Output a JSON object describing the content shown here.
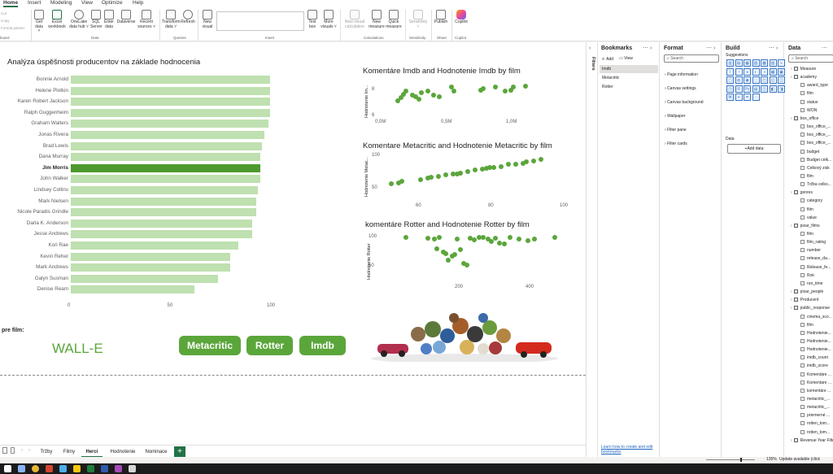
{
  "ribbon_tabs": [
    "Home",
    "Insert",
    "Modeling",
    "View",
    "Optimize",
    "Help"
  ],
  "ribbon_left_items": [
    "Cut",
    "Copy",
    "Format painter"
  ],
  "clipboard_label": "board",
  "ribbon": {
    "data": [
      {
        "label": "Get data ˅"
      },
      {
        "label": "Excel workbook"
      },
      {
        "label": "OneLake data hub ˅"
      },
      {
        "label": "SQL Server"
      },
      {
        "label": "Enter data"
      },
      {
        "label": "Dataverse"
      },
      {
        "label": "Recent sources ˅"
      }
    ],
    "queries": [
      {
        "label": "Transform data ˅"
      },
      {
        "label": "Refresh"
      }
    ],
    "insert": [
      {
        "label": "New visual"
      },
      {
        "label": "Text box"
      },
      {
        "label": "More visuals ˅"
      }
    ],
    "calculations": [
      {
        "label": "New visual calculation"
      },
      {
        "label": "New measure"
      },
      {
        "label": "Quick measure"
      }
    ],
    "sensitivity": [
      {
        "label": "Sensitivity ˅"
      }
    ],
    "share": [
      {
        "label": "Publish"
      }
    ],
    "copilot": [
      {
        "label": "Copilot"
      }
    ],
    "groups": [
      "Data",
      "Queries",
      "Insert",
      "Calculations",
      "Sensitivity",
      "Share",
      "Copilot"
    ]
  },
  "chart_data": [
    {
      "type": "bar",
      "title": "Analýza úspěšnosti producentov na základe hodnocenia",
      "categories": [
        "Bonnie Arnold",
        "Helene Plotkin",
        "Karen Robert Jackson",
        "Ralph Guggenheim",
        "Graham Walters",
        "Jonas Rivera",
        "Brad Lewis",
        "Dana Murray",
        "Jim Morris",
        "John Walker",
        "Lindsey Collins",
        "Mark Nielsen",
        "Nicole Paradis Grindle",
        "Darla K. Anderson",
        "Jesse Andrews",
        "Kori Rae",
        "Kevin Reher",
        "Mark Andrews",
        "Galyn Susman",
        "Denise Ream"
      ],
      "values": [
        100,
        100,
        100,
        100,
        99,
        97,
        96,
        95,
        95,
        95,
        94,
        93,
        93,
        91,
        91,
        84,
        80,
        80,
        74,
        62
      ],
      "highlighted": "Jim Morris",
      "xticks": [
        "0",
        "50",
        "100"
      ],
      "xlim": [
        0,
        100
      ]
    },
    {
      "type": "scatter",
      "title": "Komentáre Imdb and Hodnotenie Imdb by film",
      "ylabel": "Hodnotenie Im...",
      "xticks": [
        "0,0M",
        "0,5M",
        "1,0M"
      ],
      "yticks": [
        "6",
        "8"
      ],
      "xlim": [
        0,
        1.4
      ],
      "ylim": [
        6,
        8.6
      ],
      "x": [
        0.15,
        0.18,
        0.2,
        0.22,
        0.27,
        0.3,
        0.33,
        0.35,
        0.4,
        0.45,
        0.5,
        0.6,
        0.62,
        0.85,
        0.87,
        0.97,
        1.05,
        1.1,
        1.12,
        1.22
      ],
      "y": [
        7.2,
        7.4,
        7.7,
        7.9,
        7.6,
        7.5,
        7.3,
        7.8,
        7.9,
        7.6,
        7.5,
        8.2,
        7.9,
        8.0,
        8.1,
        8.2,
        7.9,
        8.0,
        8.2,
        8.3
      ]
    },
    {
      "type": "scatter",
      "title": "Komentare Metacritic and Hodnotenie Metacritic by film",
      "ylabel": "Hodnotenie Metac...",
      "xticks": [
        "60",
        "80",
        "100"
      ],
      "yticks": [
        "50",
        "100"
      ],
      "xlim": [
        50,
        100
      ],
      "ylim": [
        40,
        105
      ],
      "x": [
        53,
        55,
        56,
        61,
        63,
        64,
        66,
        68,
        70,
        71,
        72,
        74,
        76,
        78,
        79,
        80,
        81,
        83,
        85,
        87,
        89,
        90,
        92,
        94
      ],
      "y": [
        57,
        59,
        61,
        64,
        66,
        67,
        69,
        71,
        72,
        73,
        74,
        76,
        79,
        80,
        81,
        82,
        83,
        84,
        87,
        88,
        89,
        91,
        93,
        95
      ]
    },
    {
      "type": "scatter",
      "title": "komentáre Rotter and Hodnotenie Rotter by film",
      "ylabel": "Hodnotenie Rotter",
      "xticks": [
        "200",
        "400"
      ],
      "yticks": [
        "50",
        "100"
      ],
      "xlim": [
        60,
        480
      ],
      "ylim": [
        30,
        105
      ],
      "x": [
        125,
        175,
        190,
        195,
        200,
        210,
        215,
        220,
        230,
        235,
        240,
        248,
        255,
        262,
        270,
        280,
        290,
        300,
        310,
        318,
        326,
        336,
        346,
        360,
        380,
        400,
        415,
        460
      ],
      "y": [
        100,
        98,
        96,
        80,
        99,
        75,
        72,
        60,
        68,
        70,
        97,
        78,
        55,
        52,
        98,
        95,
        99,
        100,
        96,
        92,
        98,
        90,
        89,
        99,
        97,
        94,
        96,
        99
      ]
    }
  ],
  "slicer_label": "pre film:",
  "selected_film": "WALL-E",
  "buttons": [
    "Metacritic",
    "Rotter",
    "Imdb"
  ],
  "filters_label": "Filters",
  "bookmarks": {
    "title": "Bookmarks",
    "add": "Add",
    "view": "View",
    "items": [
      "Imdb",
      "Metacritic",
      "Rotter"
    ],
    "footer": "Learn how to create and edit bookmarks"
  },
  "format": {
    "title": "Format",
    "search_placeholder": "Search",
    "items": [
      "Page information",
      "Canvas settings",
      "Canvas background",
      "Wallpaper",
      "Filter pane",
      "Filter cards"
    ]
  },
  "build": {
    "title": "Build",
    "suggestions": "Suggestions",
    "data_label": "Data",
    "add_data": "+Add data"
  },
  "data_pane": {
    "title": "Data",
    "search_placeholder": "Search",
    "fields": [
      {
        "t": "Measure",
        "level": 0
      },
      {
        "t": "academy",
        "level": 0
      },
      {
        "t": "award_type",
        "level": 1
      },
      {
        "t": "film",
        "level": 1
      },
      {
        "t": "status",
        "level": 1
      },
      {
        "t": "WON",
        "level": 1
      },
      {
        "t": "box_office",
        "level": 0
      },
      {
        "t": "box_office_...",
        "level": 1
      },
      {
        "t": "box_office_...",
        "level": 1
      },
      {
        "t": "box_office_...",
        "level": 1
      },
      {
        "t": "budget",
        "level": 1
      },
      {
        "t": "Budget celk...",
        "level": 1
      },
      {
        "t": "Celkový zisk",
        "level": 1
      },
      {
        "t": "film",
        "level": 1
      },
      {
        "t": "Tržba celko...",
        "level": 1
      },
      {
        "t": "genres",
        "level": 0
      },
      {
        "t": "category",
        "level": 1
      },
      {
        "t": "film",
        "level": 1
      },
      {
        "t": "value",
        "level": 1
      },
      {
        "t": "pixar_films",
        "level": 0
      },
      {
        "t": "film",
        "level": 1
      },
      {
        "t": "film_rating",
        "level": 1
      },
      {
        "t": "number",
        "level": 1
      },
      {
        "t": "release_da...",
        "level": 1
      },
      {
        "t": "Release_fe...",
        "level": 1
      },
      {
        "t": "Rok",
        "level": 1
      },
      {
        "t": "run_time",
        "level": 1
      },
      {
        "t": "pixar_people",
        "level": 0
      },
      {
        "t": "Producent",
        "level": 0
      },
      {
        "t": "public_response",
        "level": 0
      },
      {
        "t": "cinema_sco...",
        "level": 1
      },
      {
        "t": "film",
        "level": 1
      },
      {
        "t": "Hodnotenie...",
        "level": 1
      },
      {
        "t": "Hodnotenie...",
        "level": 1
      },
      {
        "t": "Hodnotenie...",
        "level": 1
      },
      {
        "t": "imdb_count",
        "level": 1
      },
      {
        "t": "imdb_score",
        "level": 1
      },
      {
        "t": "Komentáre ...",
        "level": 1
      },
      {
        "t": "Komentare ...",
        "level": 1
      },
      {
        "t": "komentáre ...",
        "level": 1
      },
      {
        "t": "metacritic_...",
        "level": 1
      },
      {
        "t": "metacritic_...",
        "level": 1
      },
      {
        "t": "priemerné ...",
        "level": 1
      },
      {
        "t": "rotten_tom...",
        "level": 1
      },
      {
        "t": "rotten_tom...",
        "level": 1
      },
      {
        "t": "Revenue Year Filte...",
        "level": 0
      }
    ]
  },
  "page_tabs": [
    "Tržby",
    "Filmy",
    "Herci",
    "Hodnotenie",
    "Nominace"
  ],
  "active_page": "Herci",
  "status": {
    "zoom": "135%",
    "update": "Update available (click"
  }
}
